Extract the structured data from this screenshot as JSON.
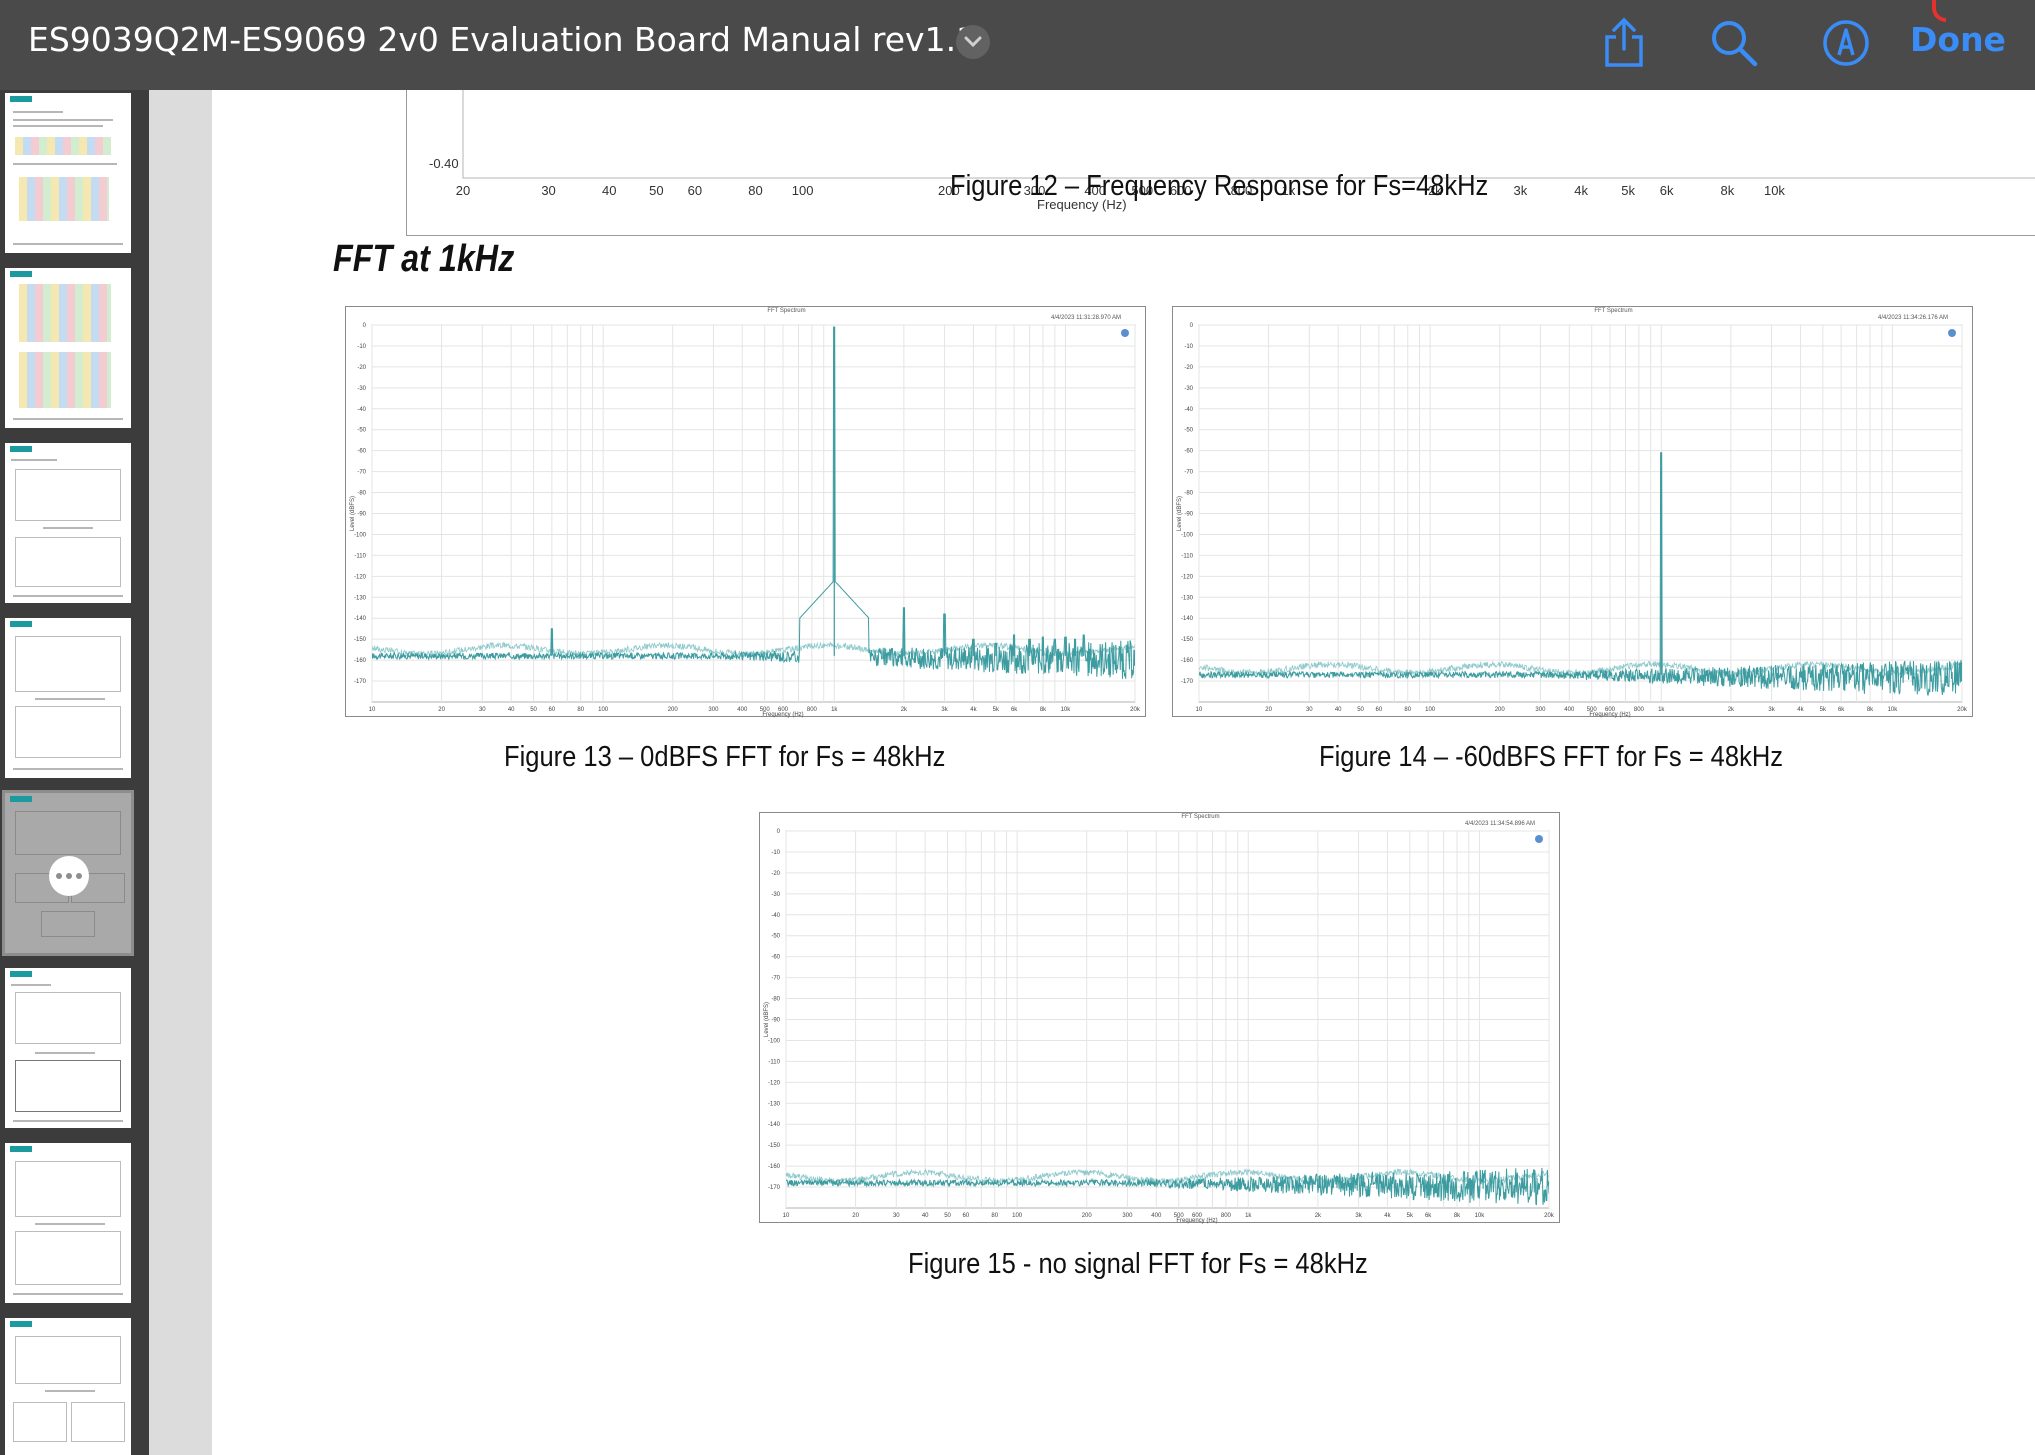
{
  "toolbar": {
    "title": "ES9039Q2M-ES9069 2v0 Evaluation Board Manual rev1.1",
    "done_label": "Done",
    "share_icon": "share-icon",
    "search_icon": "search-icon",
    "markup_icon": "markup-pen-icon",
    "accent_color": "#3a8df6"
  },
  "sidebar": {
    "selected_page": 5,
    "page_count_visible": 8
  },
  "top_chart": {
    "y_tick": "-0.40",
    "x_ticks": [
      "20",
      "30",
      "40",
      "50",
      "60",
      "80",
      "100",
      "200",
      "300",
      "400",
      "500",
      "600",
      "800",
      "1k",
      "2k",
      "3k",
      "4k",
      "5k",
      "6k",
      "8k",
      "10k"
    ],
    "xlabel": "Frequency (Hz)"
  },
  "captions": {
    "fig12": "Figure 12 – Frequency Response for Fs=48kHz",
    "fig13": "Figure 13 –  0dBFS FFT for Fs = 48kHz",
    "fig14": "Figure 14 –  -60dBFS FFT for Fs = 48kHz",
    "fig15": "Figure 15 -  no signal FFT for Fs = 48kHz"
  },
  "section_heading": "FFT at 1kHz",
  "chart_data": [
    {
      "type": "line",
      "title": "FFT Spectrum",
      "timestamp": "4/4/2023 11:31:28.970 AM",
      "xlabel": "Frequency (Hz)",
      "ylabel": "Level (dBFS)",
      "x_scale": "log",
      "xlim": [
        10,
        20000
      ],
      "ylim": [
        -180,
        0
      ],
      "x_ticks": [
        "10",
        "20",
        "30",
        "40",
        "50",
        "60",
        "80",
        "100",
        "200",
        "300",
        "400",
        "500",
        "600",
        "800",
        "1k",
        "2k",
        "3k",
        "4k",
        "5k",
        "6k",
        "8k",
        "10k",
        "20k"
      ],
      "y_ticks": [
        "0",
        "-10",
        "-20",
        "-30",
        "-40",
        "-50",
        "-60",
        "-70",
        "-80",
        "-90",
        "-100",
        "-110",
        "-120",
        "-130",
        "-140",
        "-150",
        "-160",
        "-170"
      ],
      "noise_floor_dbfs": -158,
      "peaks": [
        {
          "x": 60,
          "y": -145
        },
        {
          "x": 1000,
          "y": -1
        },
        {
          "x": 2000,
          "y": -135
        },
        {
          "x": 3000,
          "y": -138
        },
        {
          "x": 4000,
          "y": -150
        },
        {
          "x": 5000,
          "y": -152
        },
        {
          "x": 6000,
          "y": -148
        },
        {
          "x": 7000,
          "y": -150
        },
        {
          "x": 8000,
          "y": -149
        },
        {
          "x": 9000,
          "y": -150
        },
        {
          "x": 10000,
          "y": -149
        },
        {
          "x": 11000,
          "y": -150
        },
        {
          "x": 12000,
          "y": -148
        }
      ],
      "color": "#3c9ca0"
    },
    {
      "type": "line",
      "title": "FFT Spectrum",
      "timestamp": "4/4/2023 11:34:26.176 AM",
      "xlabel": "Frequency (Hz)",
      "ylabel": "Level (dBFS)",
      "x_scale": "log",
      "xlim": [
        10,
        20000
      ],
      "ylim": [
        -180,
        0
      ],
      "x_ticks": [
        "10",
        "20",
        "30",
        "40",
        "50",
        "60",
        "80",
        "100",
        "200",
        "300",
        "400",
        "500",
        "600",
        "800",
        "1k",
        "2k",
        "3k",
        "4k",
        "5k",
        "6k",
        "8k",
        "10k",
        "20k"
      ],
      "y_ticks": [
        "0",
        "-10",
        "-20",
        "-30",
        "-40",
        "-50",
        "-60",
        "-70",
        "-80",
        "-90",
        "-100",
        "-110",
        "-120",
        "-130",
        "-140",
        "-150",
        "-160",
        "-170"
      ],
      "noise_floor_dbfs": -167,
      "peaks": [
        {
          "x": 1000,
          "y": -61
        }
      ],
      "color": "#3c9ca0"
    },
    {
      "type": "line",
      "title": "FFT Spectrum",
      "timestamp": "4/4/2023 11:34:54.896 AM",
      "xlabel": "Frequency (Hz)",
      "ylabel": "Level (dBFS)",
      "x_scale": "log",
      "xlim": [
        10,
        20000
      ],
      "ylim": [
        -180,
        0
      ],
      "x_ticks": [
        "10",
        "20",
        "30",
        "40",
        "50",
        "60",
        "80",
        "100",
        "200",
        "300",
        "400",
        "500",
        "600",
        "800",
        "1k",
        "2k",
        "3k",
        "4k",
        "5k",
        "6k",
        "8k",
        "10k",
        "20k"
      ],
      "y_ticks": [
        "0",
        "-10",
        "-20",
        "-30",
        "-40",
        "-50",
        "-60",
        "-70",
        "-80",
        "-90",
        "-100",
        "-110",
        "-120",
        "-130",
        "-140",
        "-150",
        "-160",
        "-170"
      ],
      "noise_floor_dbfs": -168,
      "peaks": [],
      "color": "#3c9ca0"
    }
  ]
}
